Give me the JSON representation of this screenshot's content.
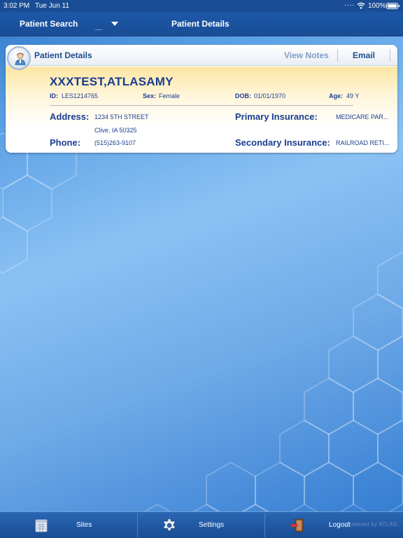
{
  "status_bar": {
    "time": "3:02 PM",
    "date": "Tue Jun 11",
    "dots": "....",
    "battery": "100%"
  },
  "nav": {
    "left_label": "Patient Search",
    "title": "Patient Details"
  },
  "card": {
    "title": "Patient Details",
    "view_notes": "View Notes",
    "email": "Email"
  },
  "patient": {
    "name": "XXXTEST,ATLASAMY",
    "id_label": "ID:",
    "id": "LES1214765",
    "sex_label": "Sex:",
    "sex": "Female",
    "dob_label": "DOB:",
    "dob": "01/01/1970",
    "age_label": "Age:",
    "age": "49 Y",
    "address_label": "Address:",
    "address_line1": "1234 5TH STREET",
    "address_line2": "Clive, IA 50325",
    "phone_label": "Phone:",
    "phone": "(515)263-9107",
    "primary_ins_label": "Primary Insurance:",
    "primary_ins": "MEDICARE PAR...",
    "secondary_ins_label": "Secondary Insurance:",
    "secondary_ins": "RAILROAD RETI..."
  },
  "tabs": [
    {
      "label": "Sites",
      "icon": "sites-icon"
    },
    {
      "label": "Settings",
      "icon": "gear-icon"
    },
    {
      "label": "Logout",
      "icon": "logout-icon"
    }
  ],
  "watermark": "Powered by ATLAS",
  "colors": {
    "bar": "#1a4d95",
    "text_blue": "#1a3d8f",
    "highlight": "#fde6a2"
  }
}
